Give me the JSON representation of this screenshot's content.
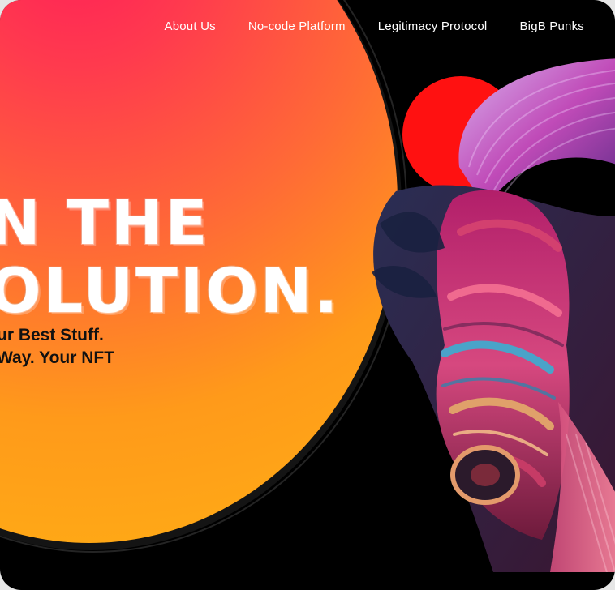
{
  "nav": {
    "items": [
      {
        "label": "About Us"
      },
      {
        "label": "No-code Platform"
      },
      {
        "label": "Legitimacy Protocol"
      },
      {
        "label": "BigB Punks"
      }
    ]
  },
  "hero": {
    "headline_line_1": "N THE",
    "headline_line_2": "OLUTION.",
    "subhead_line_1": "ur Best Stuff.",
    "subhead_line_2": " Way. Your NFT"
  },
  "colors": {
    "background": "#000000",
    "orb_gradient": [
      "#ff1f58",
      "#ff6a36",
      "#ff9a1a",
      "#ffb014"
    ],
    "text_light": "#ffffff",
    "text_dark": "#111111",
    "accent_red": "#ff1111"
  },
  "artwork": {
    "name": "nft-sculpture-artwork"
  }
}
